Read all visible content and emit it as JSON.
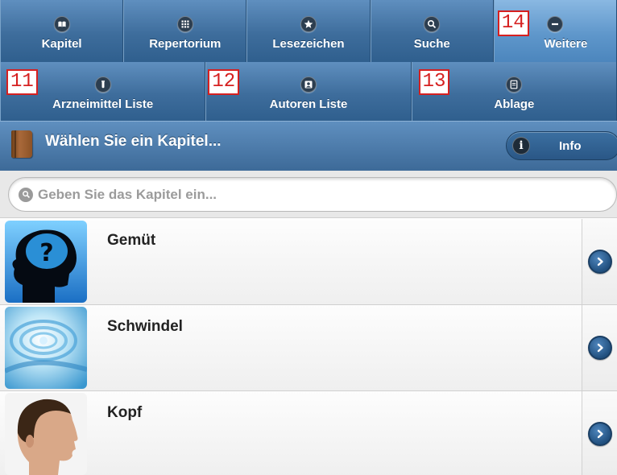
{
  "nav_row1": [
    {
      "label": "Kapitel",
      "icon": "book-open-icon"
    },
    {
      "label": "Repertorium",
      "icon": "grid-icon"
    },
    {
      "label": "Lesezeichen",
      "icon": "star-icon"
    },
    {
      "label": "Suche",
      "icon": "search-icon"
    },
    {
      "label": "Weitere",
      "icon": "minus-icon",
      "active": true
    }
  ],
  "nav_row2": [
    {
      "label": "Arzneimittel Liste",
      "icon": "vial-icon"
    },
    {
      "label": "Autoren Liste",
      "icon": "person-icon"
    },
    {
      "label": "Ablage",
      "icon": "document-icon"
    }
  ],
  "callouts": {
    "c11": "11",
    "c12": "12",
    "c13": "13",
    "c14": "14"
  },
  "header": {
    "title": "Wählen Sie ein Kapitel...",
    "info_label": "Info",
    "info_glyph": "i"
  },
  "search": {
    "placeholder": "Geben Sie das Kapitel ein..."
  },
  "chapters": [
    {
      "label": "Gemüt"
    },
    {
      "label": "Schwindel"
    },
    {
      "label": "Kopf"
    }
  ],
  "colors": {
    "accent": "#3e6d9c",
    "active_tab": "#5f97cb",
    "callout": "#d62020"
  }
}
